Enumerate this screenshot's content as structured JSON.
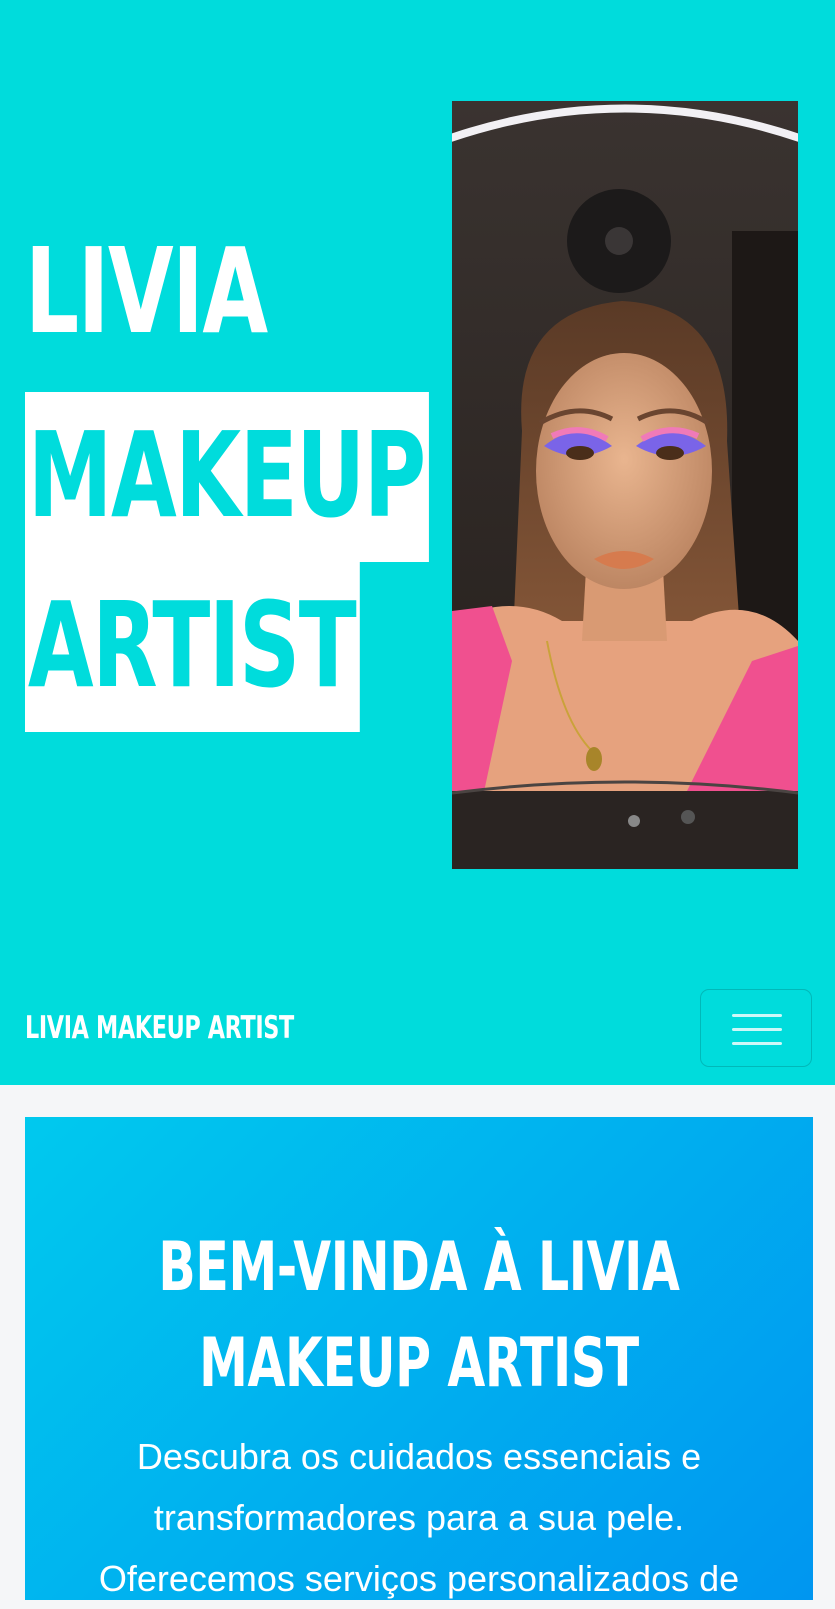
{
  "hero": {
    "title_line1": "LIVIA",
    "title_line2": "MAKEUP",
    "title_line3": "ARTIST"
  },
  "nav": {
    "brand": "LIVIA MAKEUP ARTIST",
    "toggler_icon": "hamburger-menu-icon"
  },
  "welcome": {
    "heading": "BEM-VINDA À LIVIA MAKEUP ARTIST",
    "description": "Descubra os cuidados essenciais e transformadores para a sua pele. Oferecemos serviços personalizados de"
  },
  "colors": {
    "hero_background": "#00dcdc",
    "highlight_text": "#00dcdc",
    "card_gradient_start": "#00c9ee",
    "card_gradient_end": "#0096f0"
  }
}
